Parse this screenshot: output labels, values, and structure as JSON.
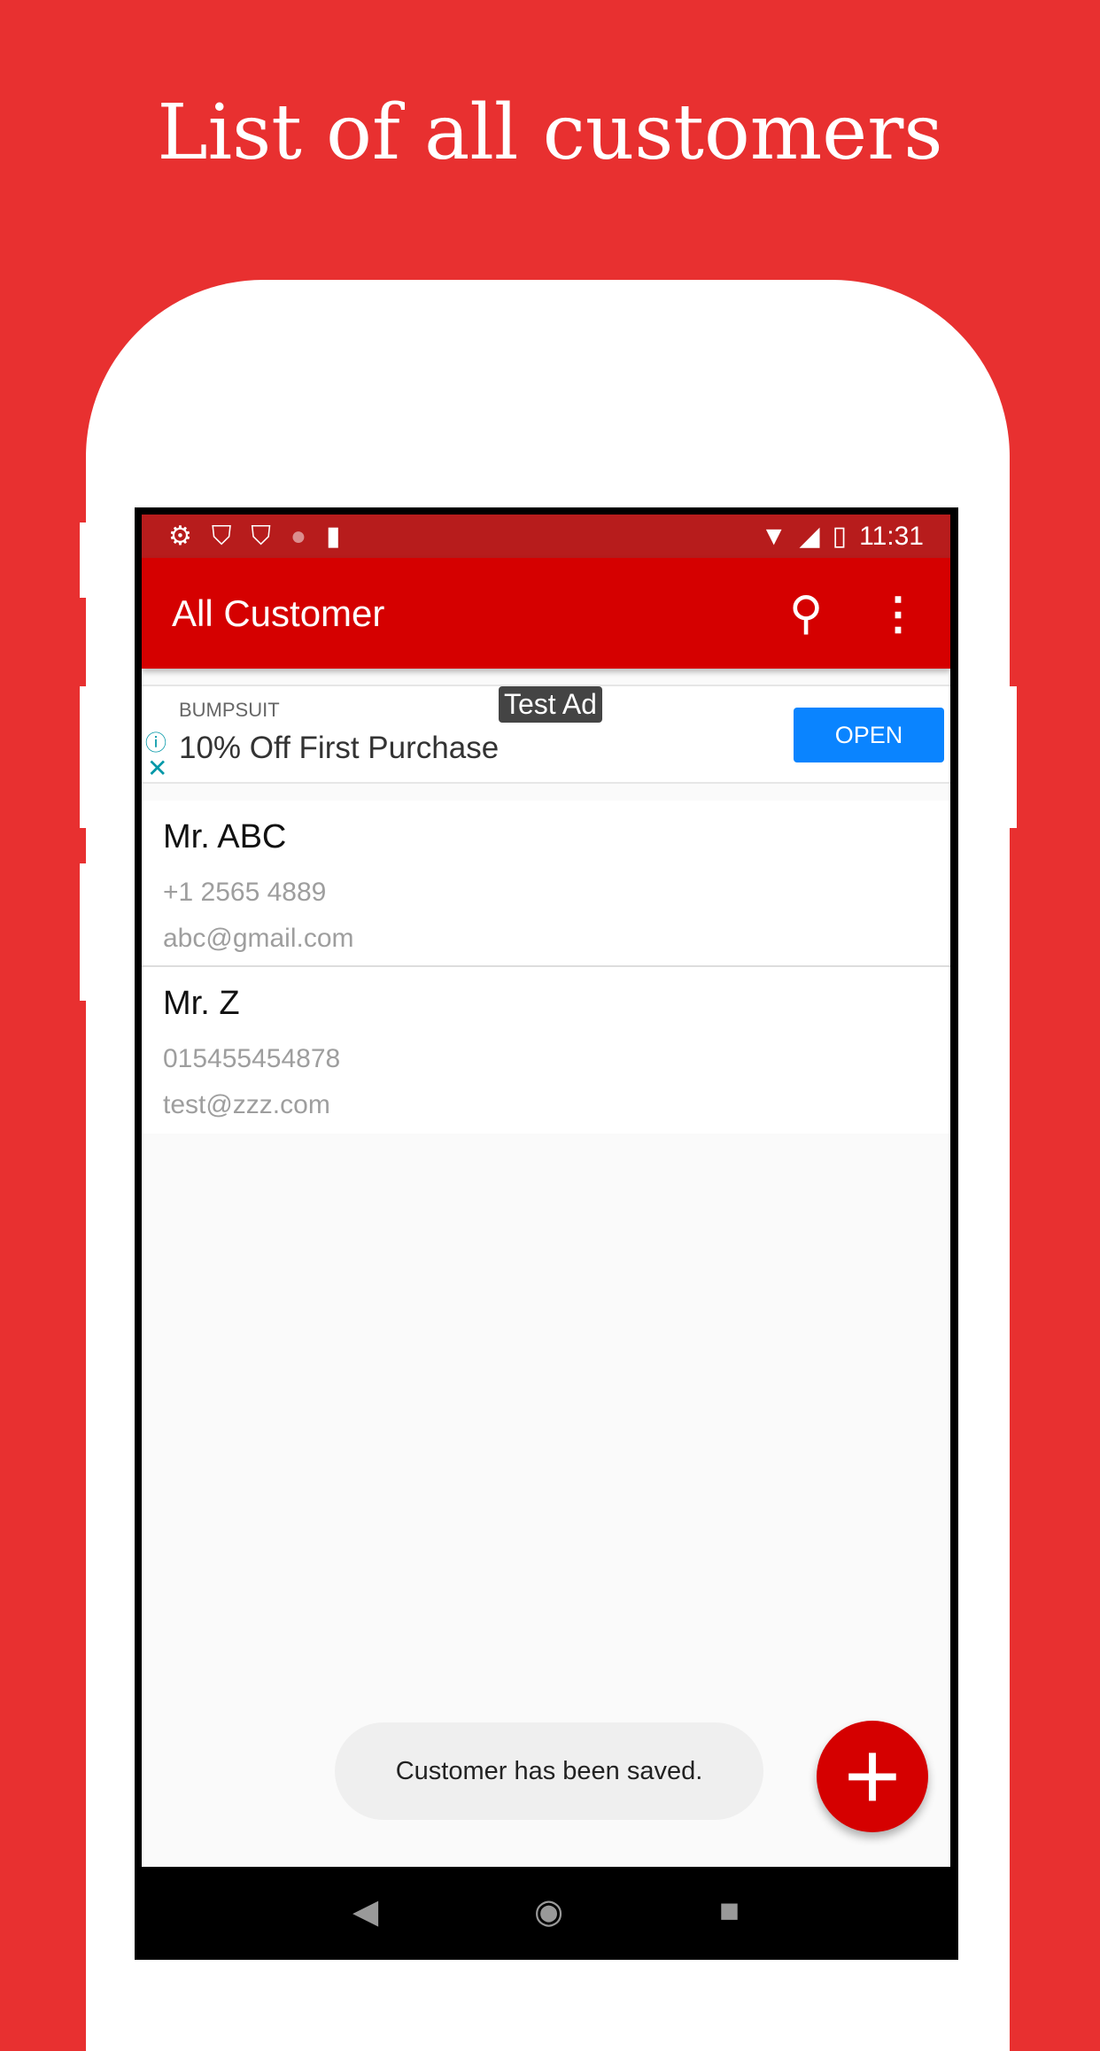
{
  "title": "List of all customers",
  "status": {
    "time": "11:31",
    "icons": [
      "settings-icon",
      "shield-play-icon",
      "shield-play-icon",
      "loading-icon",
      "sd-card-icon",
      "wifi-off-icon",
      "signal-icon",
      "battery-charging-icon"
    ]
  },
  "appbar": {
    "title": "All Customer",
    "search_icon": "search-icon",
    "more_icon": "more-vert-icon"
  },
  "ad": {
    "label": "Test Ad",
    "advertiser": "BUMPSUIT",
    "headline": "10% Off First Purchase",
    "cta": "OPEN"
  },
  "customers": [
    {
      "name": "Mr. ABC",
      "phone": "+1 2565 4889",
      "email": "abc@gmail.com"
    },
    {
      "name": "Mr. Z",
      "phone": "015455454878",
      "email": "test@zzz.com"
    }
  ],
  "toast": "Customer has been saved.",
  "colors": {
    "background": "#e83030",
    "appbar": "#d50000",
    "statusbar": "#b71c1c",
    "ad_button": "#0a84ff"
  }
}
